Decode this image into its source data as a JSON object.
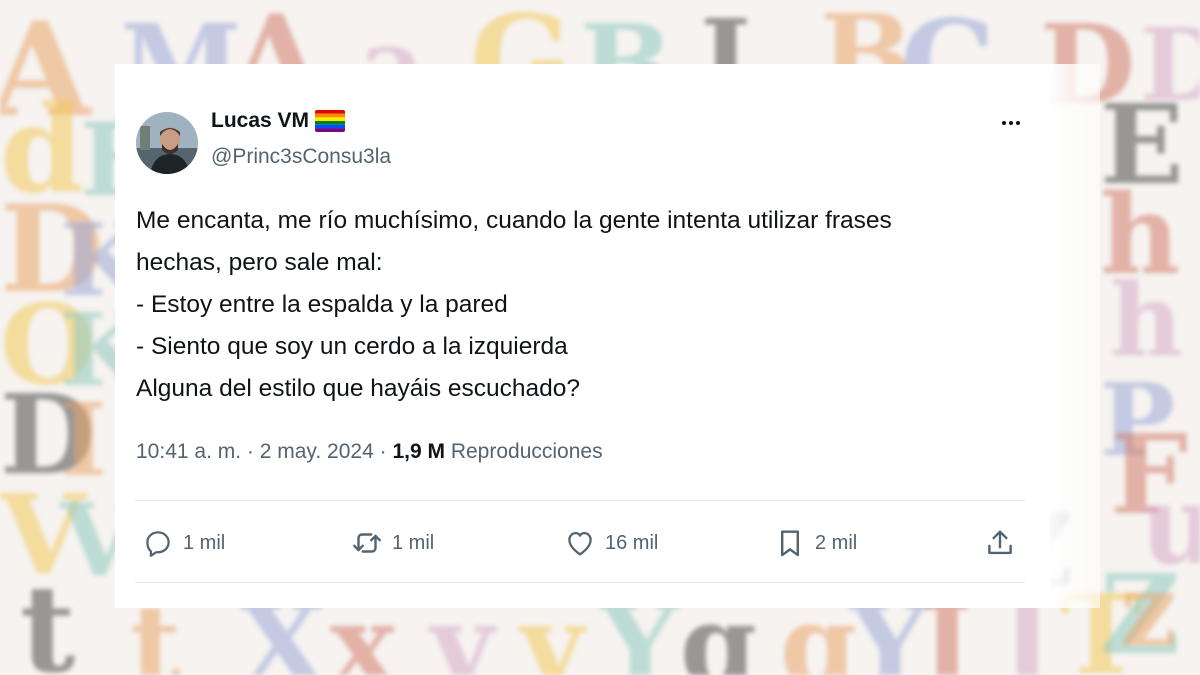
{
  "background": {
    "letters": [
      "A",
      "M",
      "A",
      "a",
      "G",
      "B",
      "L",
      "B",
      "C",
      "D",
      "D",
      "d",
      "E",
      "E",
      "D",
      "K",
      "h",
      "h",
      "O",
      "K",
      "D",
      "I",
      "P",
      "F",
      "u",
      "V",
      "V",
      "t",
      "t",
      "X",
      "x",
      "y",
      "y",
      "Y",
      "g",
      "g",
      "Y",
      "J",
      "J",
      "T",
      "Z",
      "Z",
      "z"
    ],
    "colors": [
      "#e9a46a",
      "#9aa8d8",
      "#d47c6a",
      "#d5a9c8",
      "#f3c85a",
      "#8fc9c0",
      "#4b4b4b"
    ]
  },
  "tweet": {
    "avatar_icon": "profile-photo",
    "author_name": "Lucas VM",
    "flag_icon": "rainbow-flag-emoji",
    "handle": "@Princ3sConsu3la",
    "more_icon": "more-horizontal-icon",
    "lines": [
      "Me encanta, me río muchísimo, cuando la gente intenta utilizar frases",
      "hechas, pero sale mal:",
      "- Estoy entre la espalda y la pared",
      "- Siento que soy un cerdo a la izquierda",
      "Alguna del estilo que hayáis escuchado?"
    ],
    "time": "10:41 a. m.",
    "separator": "·",
    "date": "2 may. 2024",
    "views_count": "1,9 M",
    "views_label": "Reproducciones",
    "actions": {
      "reply_count": "1 mil",
      "retweet_count": "1 mil",
      "like_count": "16 mil",
      "bookmark_count": "2 mil"
    }
  },
  "colors": {
    "text_primary": "#0f1419",
    "text_secondary": "#536471",
    "divider": "#e6e9eb"
  }
}
